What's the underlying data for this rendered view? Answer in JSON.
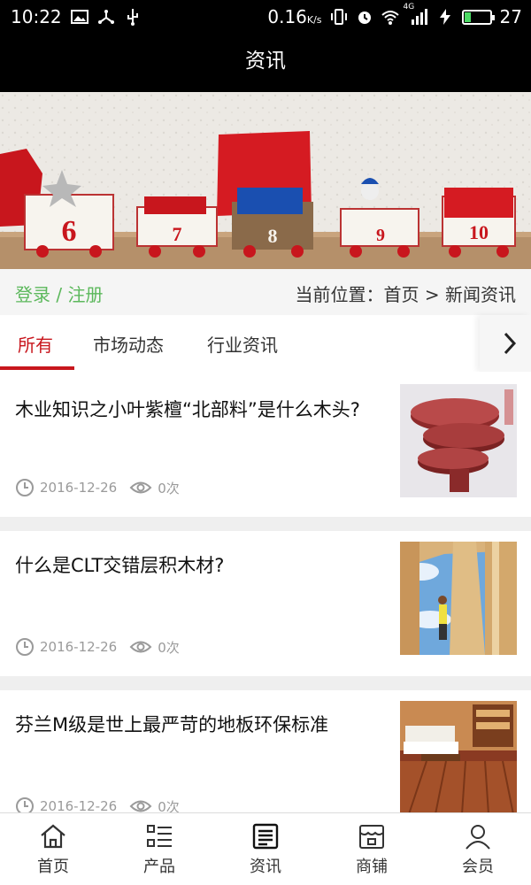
{
  "status_bar": {
    "time": "10:22",
    "net_speed": "0.16",
    "net_unit": "K/s",
    "signal_type": "4G",
    "battery_level": "27",
    "icons": [
      "image-icon",
      "usb-share-icon",
      "usb-icon",
      "vibrate-icon",
      "alarm-icon",
      "wifi-icon",
      "signal-icon",
      "charging-icon",
      "battery-icon"
    ]
  },
  "header": {
    "title": "资讯"
  },
  "banner": {
    "labels": [
      "6",
      "7",
      "8",
      "9",
      "10"
    ]
  },
  "crumbs": {
    "login": "登录",
    "slash": "/",
    "register": "注册",
    "path": "当前位置：首页 > 新闻资讯"
  },
  "tabs": {
    "items": [
      {
        "label": "所有"
      },
      {
        "label": "市场动态"
      },
      {
        "label": "行业资讯"
      }
    ],
    "active_index": 0,
    "more_icon": "chevron-right-icon"
  },
  "news": [
    {
      "title": "木业知识之小叶紫檀“北部料”是什么木头?",
      "date": "2016-12-26",
      "views": "0次"
    },
    {
      "title": "什么是CLT交错层积木材?",
      "date": "2016-12-26",
      "views": "0次"
    },
    {
      "title": "芬兰M级是世上最严苛的地板环保标准",
      "date": "2016-12-26",
      "views": "0次"
    }
  ],
  "bottom_nav": [
    {
      "label": "首页",
      "icon": "home-icon"
    },
    {
      "label": "产品",
      "icon": "list-icon"
    },
    {
      "label": "资讯",
      "icon": "news-icon"
    },
    {
      "label": "商铺",
      "icon": "shop-icon"
    },
    {
      "label": "会员",
      "icon": "user-icon"
    }
  ],
  "colors": {
    "accent": "#c8161d",
    "auth_green": "#5cb85c",
    "bar_black": "#000000",
    "meta_gray": "#9a9a9a"
  }
}
